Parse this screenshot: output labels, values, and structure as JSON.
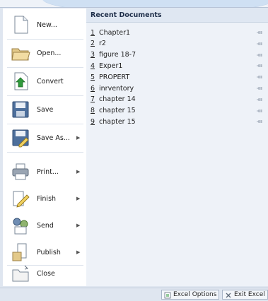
{
  "menu_items": [
    {
      "label": "New...",
      "icon": "new-document-icon",
      "arrow": false
    },
    {
      "label": "Open...",
      "icon": "open-folder-icon",
      "arrow": false
    },
    {
      "label": "Convert",
      "icon": "convert-icon",
      "arrow": false
    },
    {
      "label": "Save",
      "icon": "save-disk-icon",
      "arrow": false
    },
    {
      "label": "Save As...",
      "icon": "save-as-icon",
      "arrow": true
    },
    {
      "label": "Print...",
      "icon": "printer-icon",
      "arrow": true
    },
    {
      "label": "Finish",
      "icon": "finish-pen-icon",
      "arrow": true
    },
    {
      "label": "Send",
      "icon": "send-icon",
      "arrow": true
    },
    {
      "label": "Publish",
      "icon": "publish-icon",
      "arrow": true
    },
    {
      "label": "Close",
      "icon": "close-folder-icon",
      "arrow": false
    }
  ],
  "recent": {
    "title": "Recent Documents",
    "items": [
      {
        "num": "1",
        "name": "Chapter1"
      },
      {
        "num": "2",
        "name": "r2"
      },
      {
        "num": "3",
        "name": "figure 18-7"
      },
      {
        "num": "4",
        "name": "Exper1"
      },
      {
        "num": "5",
        "name": "PROPERT"
      },
      {
        "num": "6",
        "name": "inrventory"
      },
      {
        "num": "7",
        "name": "chapter 14"
      },
      {
        "num": "8",
        "name": "chapter 15"
      },
      {
        "num": "9",
        "name": "chapter 15"
      }
    ]
  },
  "buttons": {
    "options": "Excel Options",
    "exit": "Exit Excel"
  }
}
